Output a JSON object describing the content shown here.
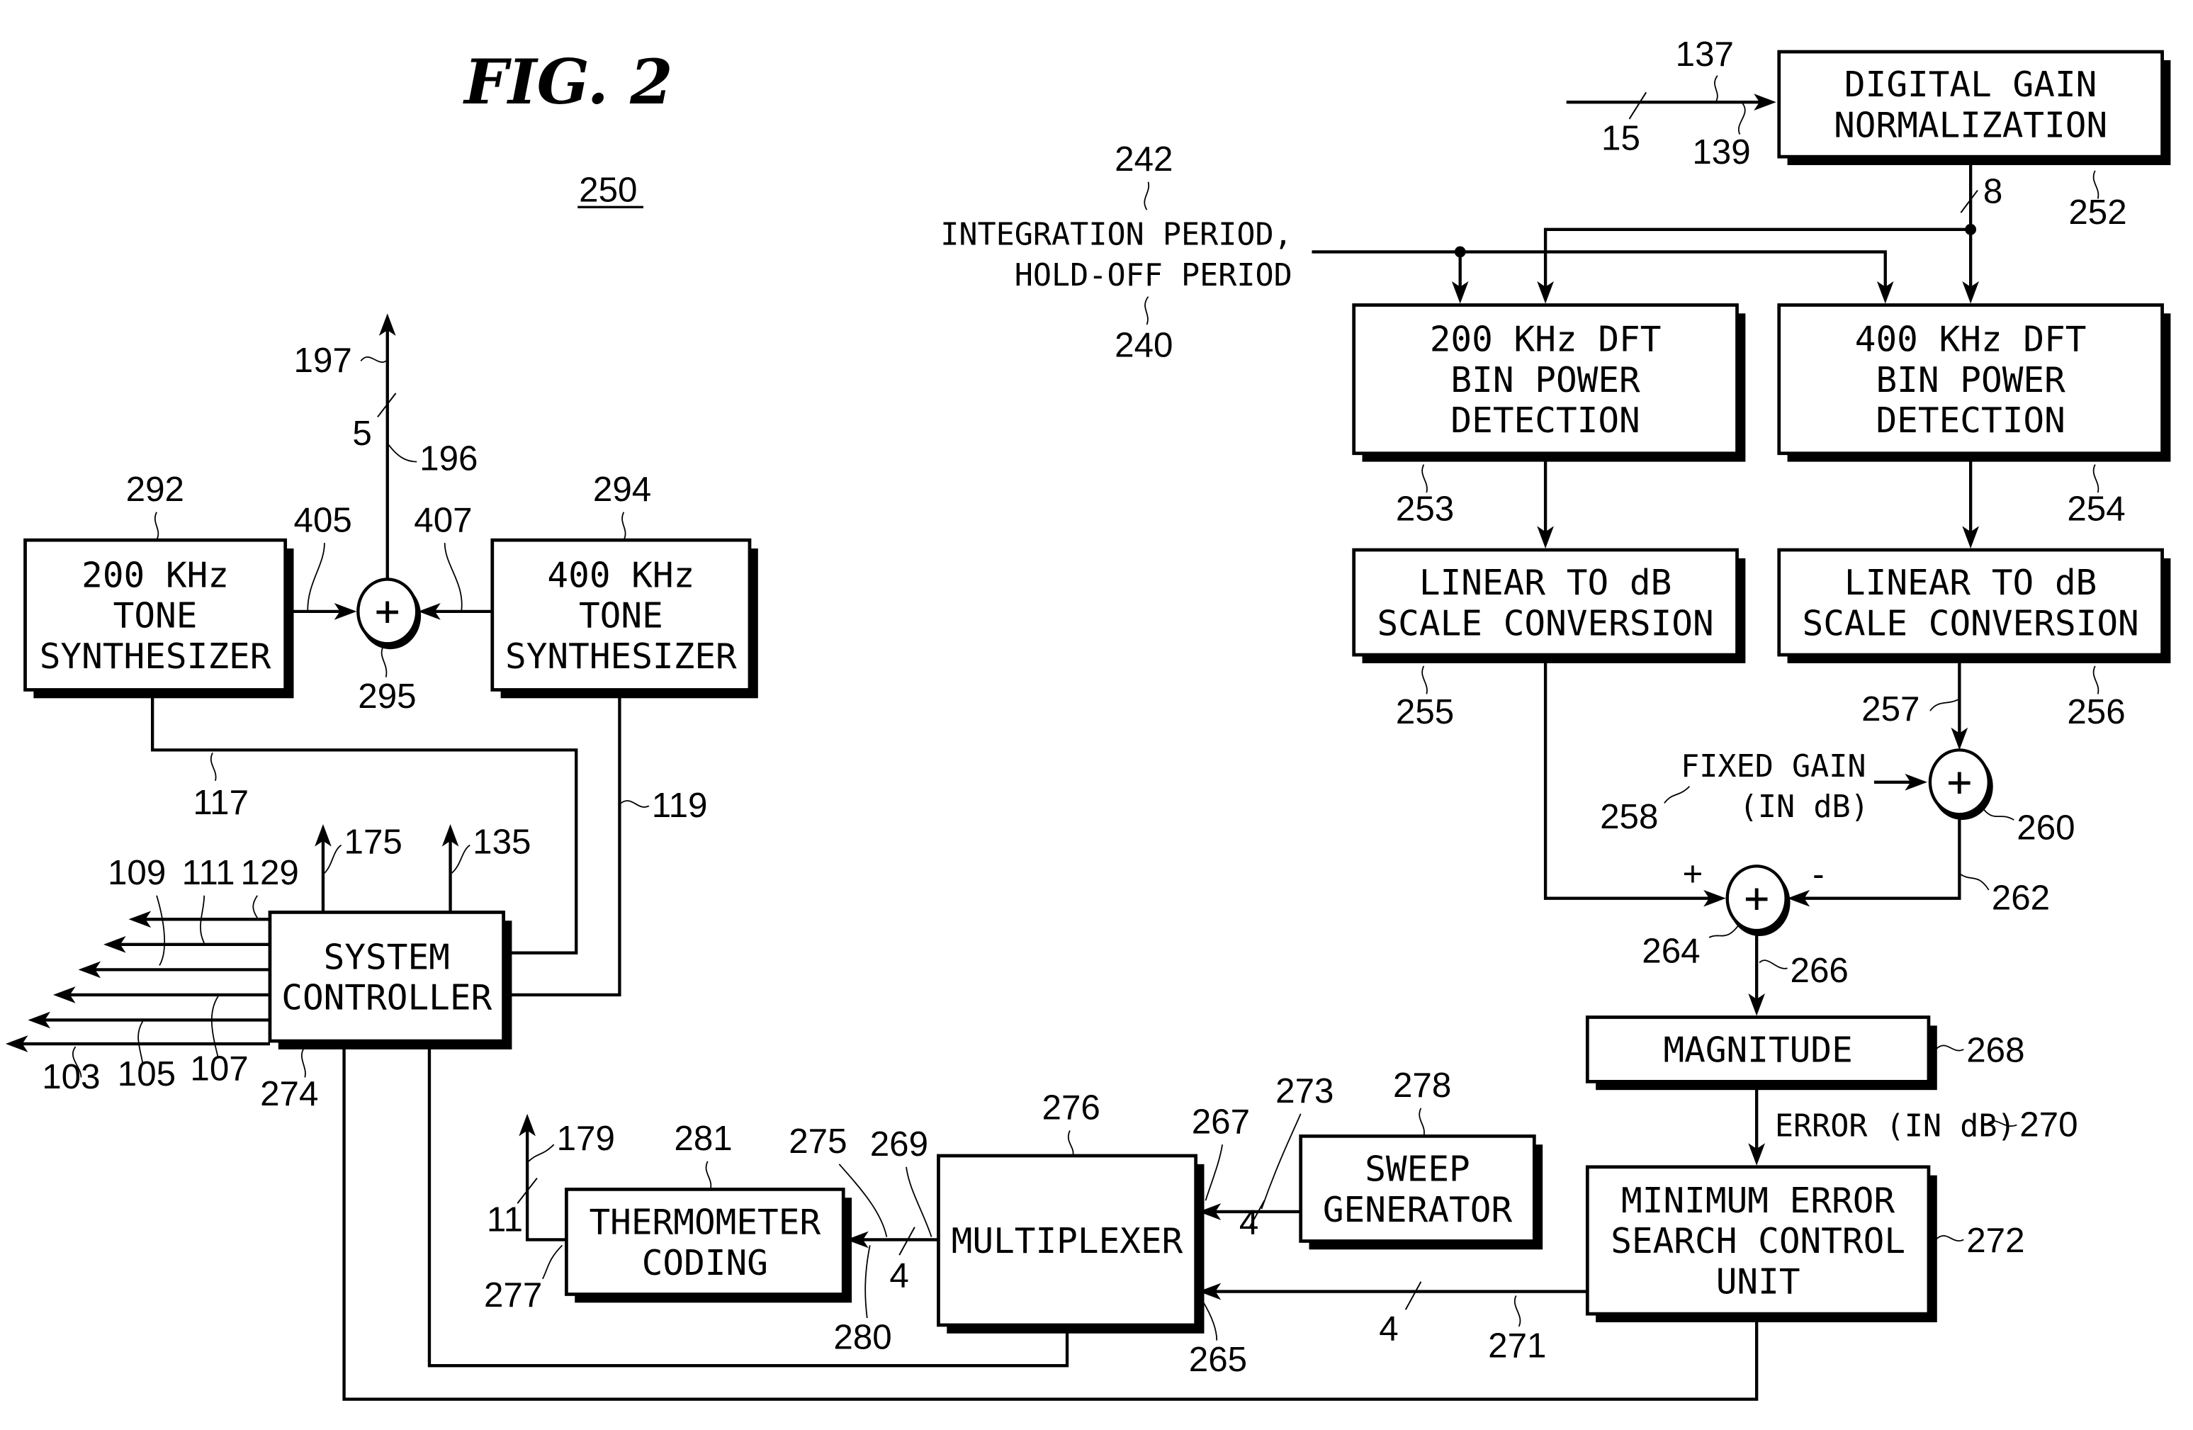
{
  "figure": {
    "title": "FIG. 2",
    "system_ref": "250"
  },
  "blocks": {
    "digital_gain": {
      "lines": [
        "DIGITAL GAIN",
        "NORMALIZATION"
      ],
      "ref": "252"
    },
    "dft200": {
      "lines": [
        "200 KHz DFT",
        "BIN POWER",
        "DETECTION"
      ],
      "ref": "253"
    },
    "dft400": {
      "lines": [
        "400 KHz DFT",
        "BIN POWER",
        "DETECTION"
      ],
      "ref": "254"
    },
    "lin2db_a": {
      "lines": [
        "LINEAR TO dB",
        "SCALE CONVERSION"
      ],
      "ref": "255"
    },
    "lin2db_b": {
      "lines": [
        "LINEAR TO dB",
        "SCALE CONVERSION"
      ],
      "ref": "256"
    },
    "magnitude": {
      "lines": [
        "MAGNITUDE"
      ],
      "ref": "268"
    },
    "min_error": {
      "lines": [
        "MINIMUM ERROR",
        "SEARCH CONTROL",
        "UNIT"
      ],
      "ref": "272"
    },
    "sweep": {
      "lines": [
        "SWEEP",
        "GENERATOR"
      ],
      "ref": "278"
    },
    "mux": {
      "lines": [
        "MULTIPLEXER"
      ],
      "ref": "276"
    },
    "thermo": {
      "lines": [
        "THERMOMETER",
        "CODING"
      ],
      "ref": "281"
    },
    "sysctl": {
      "lines": [
        "SYSTEM",
        "CONTROLLER"
      ],
      "ref": "274"
    },
    "tone200": {
      "lines": [
        "200 KHz",
        "TONE",
        "SYNTHESIZER"
      ],
      "ref": "292"
    },
    "tone400": {
      "lines": [
        "400 KHz",
        "TONE",
        "SYNTHESIZER"
      ],
      "ref": "294"
    }
  },
  "summers": {
    "s295": {
      "symbol": "+",
      "ref": "295"
    },
    "s260": {
      "symbol": "+",
      "ref": "260"
    },
    "s264": {
      "symbol": "+",
      "ref": "264",
      "plus_sign": "+",
      "minus_sign": "-"
    }
  },
  "signals": {
    "input_bus_width": "15",
    "input_ref_a": "137",
    "input_ref_b": "139",
    "norm_bus_width": "8",
    "integration_text": [
      "INTEGRATION PERIOD,",
      "HOLD-OFF PERIOD"
    ],
    "integration_ref": "242",
    "holdoff_ref": "240",
    "fixed_gain_text": [
      "FIXED GAIN",
      "(IN dB)"
    ],
    "fixed_gain_ref": "258",
    "ref_257": "257",
    "ref_262": "262",
    "ref_266": "266",
    "error_text": "ERROR (IN dB)",
    "error_ref": "270",
    "ref_271": "271",
    "bus_271_width": "4",
    "ref_273": "273",
    "bus_273_width": "4",
    "ref_267": "267",
    "ref_265": "265",
    "ref_269": "269",
    "ref_275": "275",
    "ref_280": "280",
    "bus_280_width": "4",
    "ref_277": "277",
    "ref_179": "179",
    "bus_179_width": "11",
    "ref_197": "197",
    "ref_196": "196",
    "bus_196_width": "5",
    "ref_405": "405",
    "ref_407": "407",
    "ref_117": "117",
    "ref_119": "119",
    "ref_175": "175",
    "ref_135": "135",
    "ctl_outputs": [
      "109",
      "111",
      "129",
      "103",
      "105",
      "107"
    ]
  }
}
